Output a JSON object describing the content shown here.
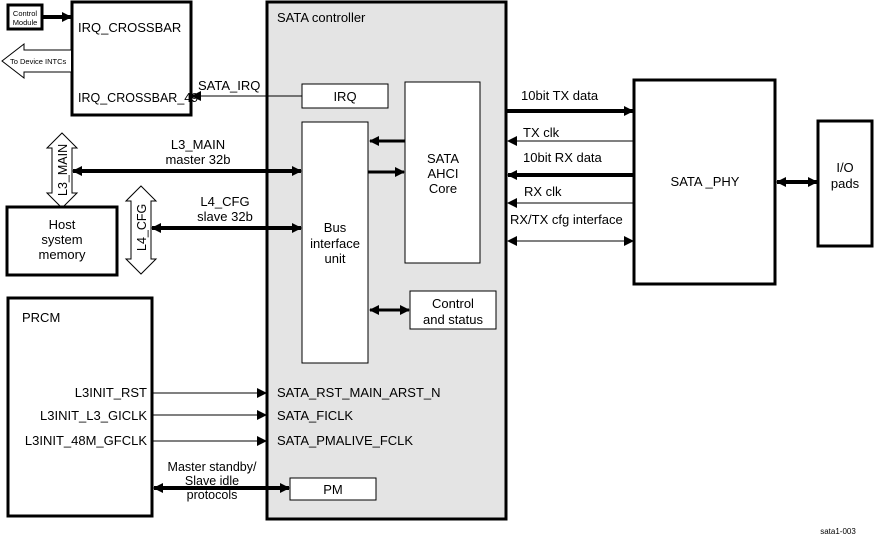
{
  "diagram": {
    "figure_id": "sata1-003",
    "colors": {
      "controller_fill": "#e4e4e4",
      "stroke": "#000000",
      "block_fill": "#ffffff"
    },
    "blocks": {
      "control_module": [
        "Control",
        "Module"
      ],
      "irq_crossbar": {
        "title": "IRQ_CROSSBAR",
        "port": "IRQ_CROSSBAR_49"
      },
      "to_device_intcs": "To Device INTCs",
      "host_memory": [
        "Host",
        "system",
        "memory"
      ],
      "prcm": {
        "title": "PRCM",
        "outputs": [
          "L3INIT_RST",
          "L3INIT_L3_GICLK",
          "L3INIT_48M_GFCLK"
        ]
      },
      "sata_controller": {
        "title": "SATA controller",
        "irq": "IRQ",
        "bus_interface": [
          "Bus",
          "interface",
          "unit"
        ],
        "ahci_core": [
          "SATA",
          "AHCI",
          "Core"
        ],
        "control_status": [
          "Control",
          "and status"
        ],
        "pm": "PM",
        "inputs": [
          "SATA_RST_MAIN_ARST_N",
          "SATA_FICLK",
          "SATA_PMALIVE_FCLK"
        ]
      },
      "sata_phy": "SATA _PHY",
      "io_pads": [
        "I/O",
        "pads"
      ]
    },
    "buses": {
      "l3_main": "L3_MAIN",
      "l4_cfg": "L4_CFG"
    },
    "signals": {
      "sata_irq": "SATA_IRQ",
      "l3_main": [
        "L3_MAIN",
        "master 32b"
      ],
      "l4_cfg": [
        "L4_CFG",
        "slave 32b"
      ],
      "tx_data": "10bit TX data",
      "tx_clk": "TX clk",
      "rx_data": "10bit RX data",
      "rx_clk": "RX clk",
      "cfg_interface": "RX/TX cfg interface",
      "pm_protocols": [
        "Master standby/",
        "Slave idle",
        "protocols"
      ]
    }
  }
}
